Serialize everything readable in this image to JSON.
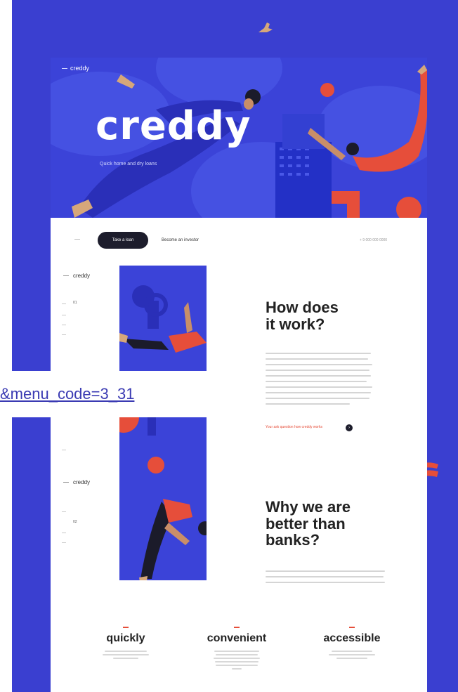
{
  "hero": {
    "brand_small": "creddy",
    "title": "creddy",
    "subtitle": "Quick home and dry loans"
  },
  "nav": {
    "primary_button": "Take a loan",
    "link": "Become an investor",
    "right_text": "+ 9 000 000 0000"
  },
  "section1": {
    "logo": "creddy",
    "side_number": "01",
    "heading_line1": "How does",
    "heading_line2": "it work?",
    "read_more": "Your ask question how creddy works"
  },
  "section2": {
    "logo": "creddy",
    "side_number": "02",
    "heading_line1": "Why we are",
    "heading_line2": "better than",
    "heading_line3": "banks?"
  },
  "features": [
    {
      "title": "quickly"
    },
    {
      "title": "convenient"
    },
    {
      "title": "accessible"
    }
  ],
  "link_overlay": "&menu_code=3_31",
  "colors": {
    "brand_blue": "#3b43d8",
    "accent_red": "#e64e3a",
    "dark": "#1d1d2c"
  }
}
